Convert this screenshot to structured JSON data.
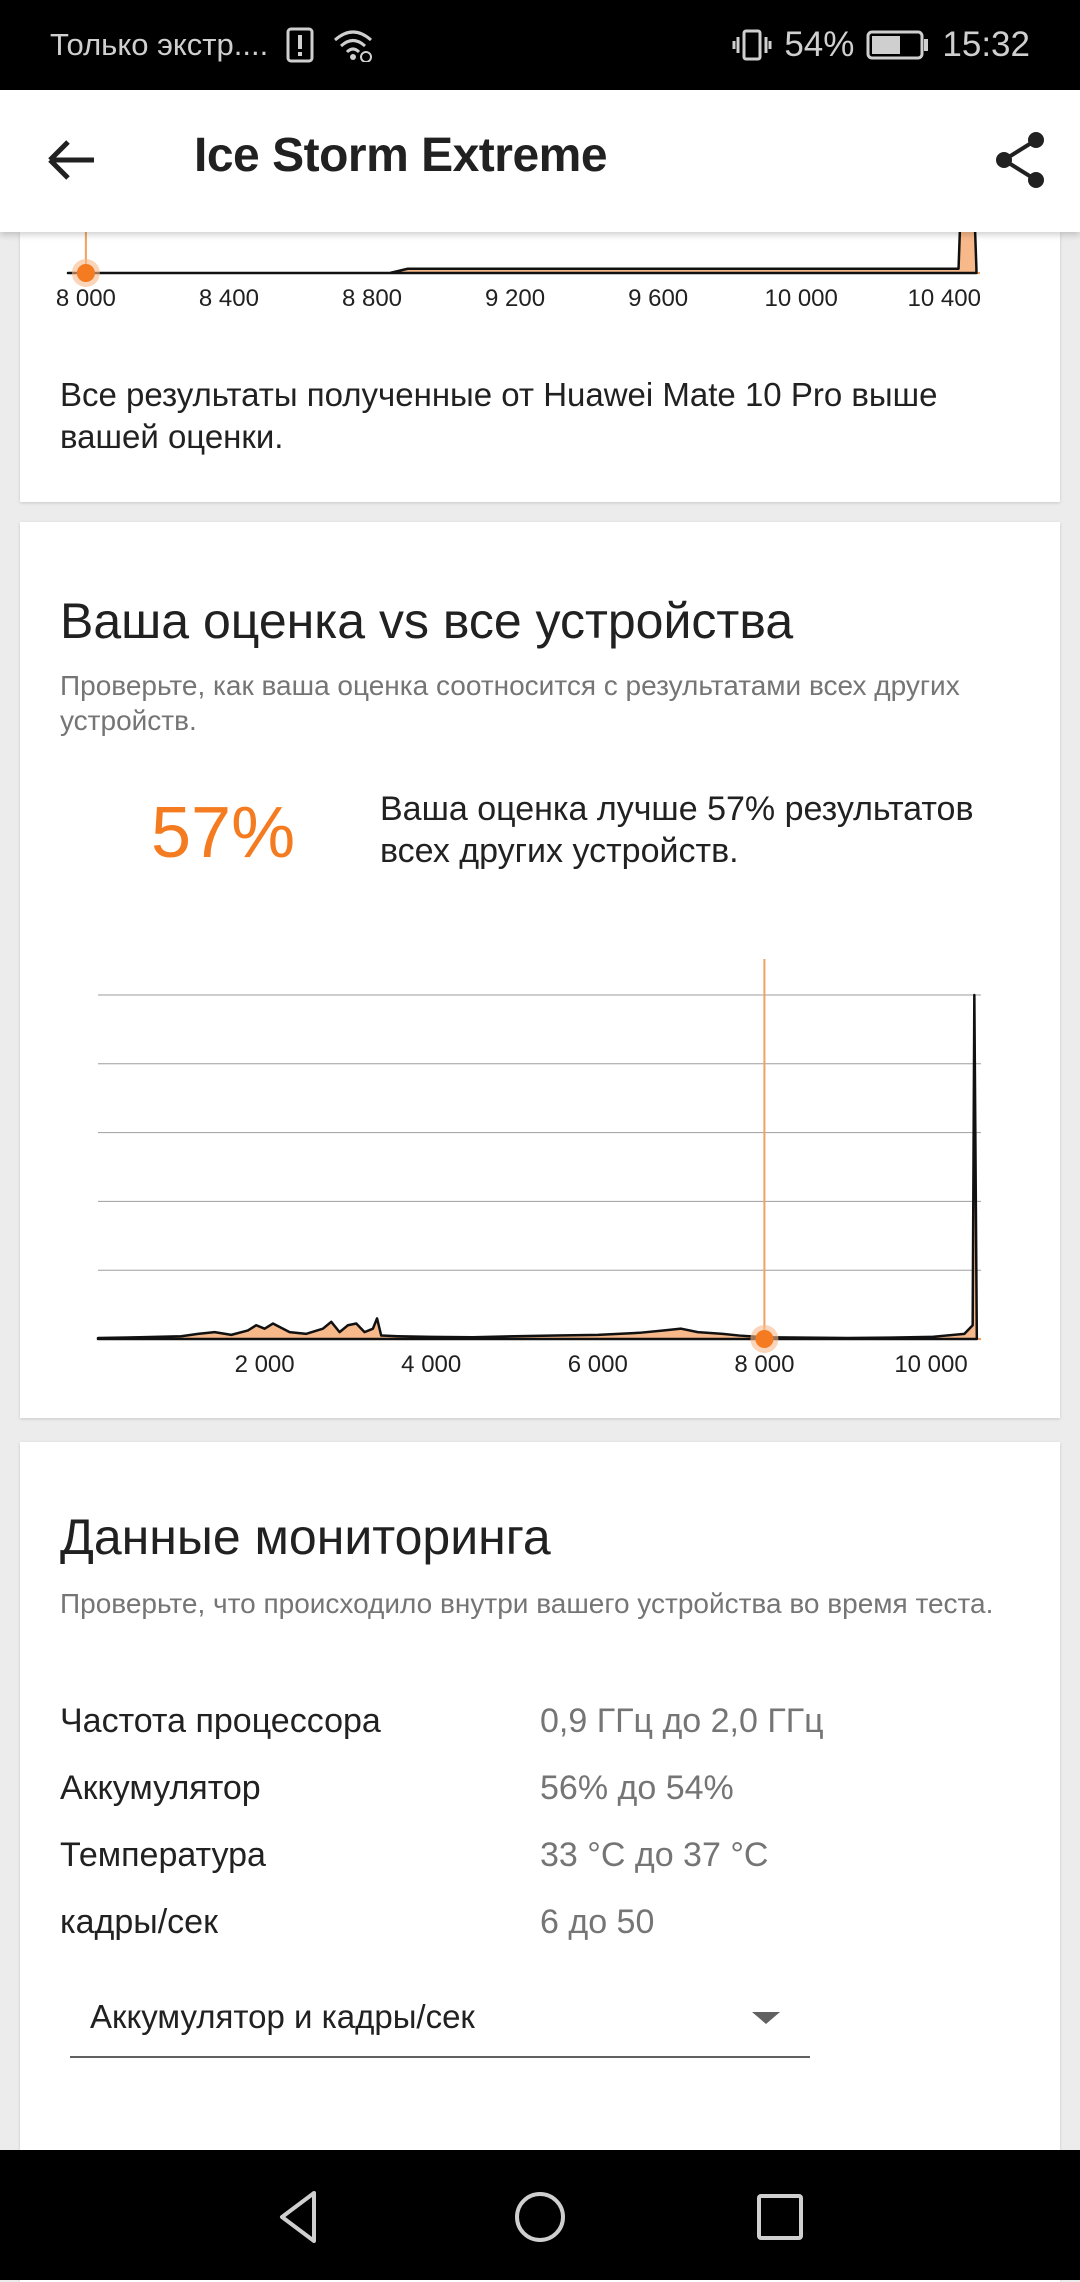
{
  "status_bar": {
    "carrier": "Только экстр....",
    "battery": "54%",
    "time": "15:32"
  },
  "app_bar": {
    "title": "Ice Storm Extreme",
    "back_icon": "arrow-back-icon",
    "share_icon": "share-icon"
  },
  "top_card": {
    "axis_labels": [
      "8 000",
      "8 400",
      "8 800",
      "9 200",
      "9 600",
      "10 000",
      "10 400"
    ],
    "message": "Все результаты полученные от Huawei Mate 10 Pro выше вашей оценки."
  },
  "comparison": {
    "heading": "Ваша оценка vs все устройства",
    "subtitle": "Проверьте, как ваша оценка соотносится с результатами всех других устройств.",
    "percent": "57%",
    "description": "Ваша оценка лучше 57% результатов всех других устройств."
  },
  "chart_data": [
    {
      "type": "area",
      "xlim": [
        7950,
        10500
      ],
      "x_ticks": [
        8000,
        8400,
        8800,
        9200,
        9600,
        10000,
        10400
      ],
      "tick_labels": [
        "8 000",
        "8 400",
        "8 800",
        "9 200",
        "9 600",
        "10 000",
        "10 400"
      ],
      "marker_x": 8000,
      "x": [
        7950,
        8000,
        8400,
        8850,
        8900,
        10000,
        10440,
        10450,
        10480,
        10490
      ],
      "y": [
        0,
        0,
        0,
        0,
        0.04,
        0.04,
        0.04,
        1,
        1,
        0.04
      ],
      "color": "#f47b20",
      "fill": "#f7b98a"
    },
    {
      "type": "area",
      "xlim": [
        0,
        10600
      ],
      "x_ticks": [
        2000,
        4000,
        6000,
        8000,
        10000
      ],
      "tick_labels": [
        "2 000",
        "4 000",
        "6 000",
        "8 000",
        "10 000"
      ],
      "marker_x": 8000,
      "grid": true,
      "x": [
        0,
        500,
        1000,
        1200,
        1400,
        1600,
        1800,
        1900,
        2000,
        2100,
        2300,
        2500,
        2700,
        2800,
        2900,
        3000,
        3100,
        3200,
        3300,
        3350,
        3400,
        3600,
        4000,
        4500,
        5000,
        5500,
        6000,
        6500,
        6800,
        7000,
        7200,
        7500,
        7700,
        8000,
        8500,
        9000,
        9500,
        10000,
        10400,
        10500,
        10520,
        10550
      ],
      "y": [
        0.003,
        0.005,
        0.008,
        0.015,
        0.02,
        0.012,
        0.025,
        0.04,
        0.03,
        0.045,
        0.02,
        0.015,
        0.03,
        0.05,
        0.02,
        0.04,
        0.045,
        0.02,
        0.03,
        0.06,
        0.01,
        0.008,
        0.006,
        0.005,
        0.008,
        0.01,
        0.012,
        0.018,
        0.025,
        0.03,
        0.02,
        0.015,
        0.01,
        0.005,
        0.004,
        0.003,
        0.004,
        0.006,
        0.015,
        0.04,
        1,
        0
      ],
      "color": "#f47b20",
      "fill": "#f7b98a"
    }
  ],
  "monitoring": {
    "heading": "Данные мониторинга",
    "subtitle": "Проверьте, что происходило внутри вашего устройства во время теста.",
    "rows": [
      {
        "label": "Частота процессора",
        "value": "0,9 ГГц до 2,0 ГГц"
      },
      {
        "label": "Аккумулятор",
        "value": "56% до 54%"
      },
      {
        "label": "Температура",
        "value": "33 °C до 37 °C"
      },
      {
        "label": "кадры/сек",
        "value": "6 до 50"
      }
    ],
    "dropdown_value": "Аккумулятор и кадры/сек"
  },
  "nav": {
    "back_icon": "triangle-back-icon",
    "home_icon": "circle-home-icon",
    "recents_icon": "square-recents-icon"
  }
}
